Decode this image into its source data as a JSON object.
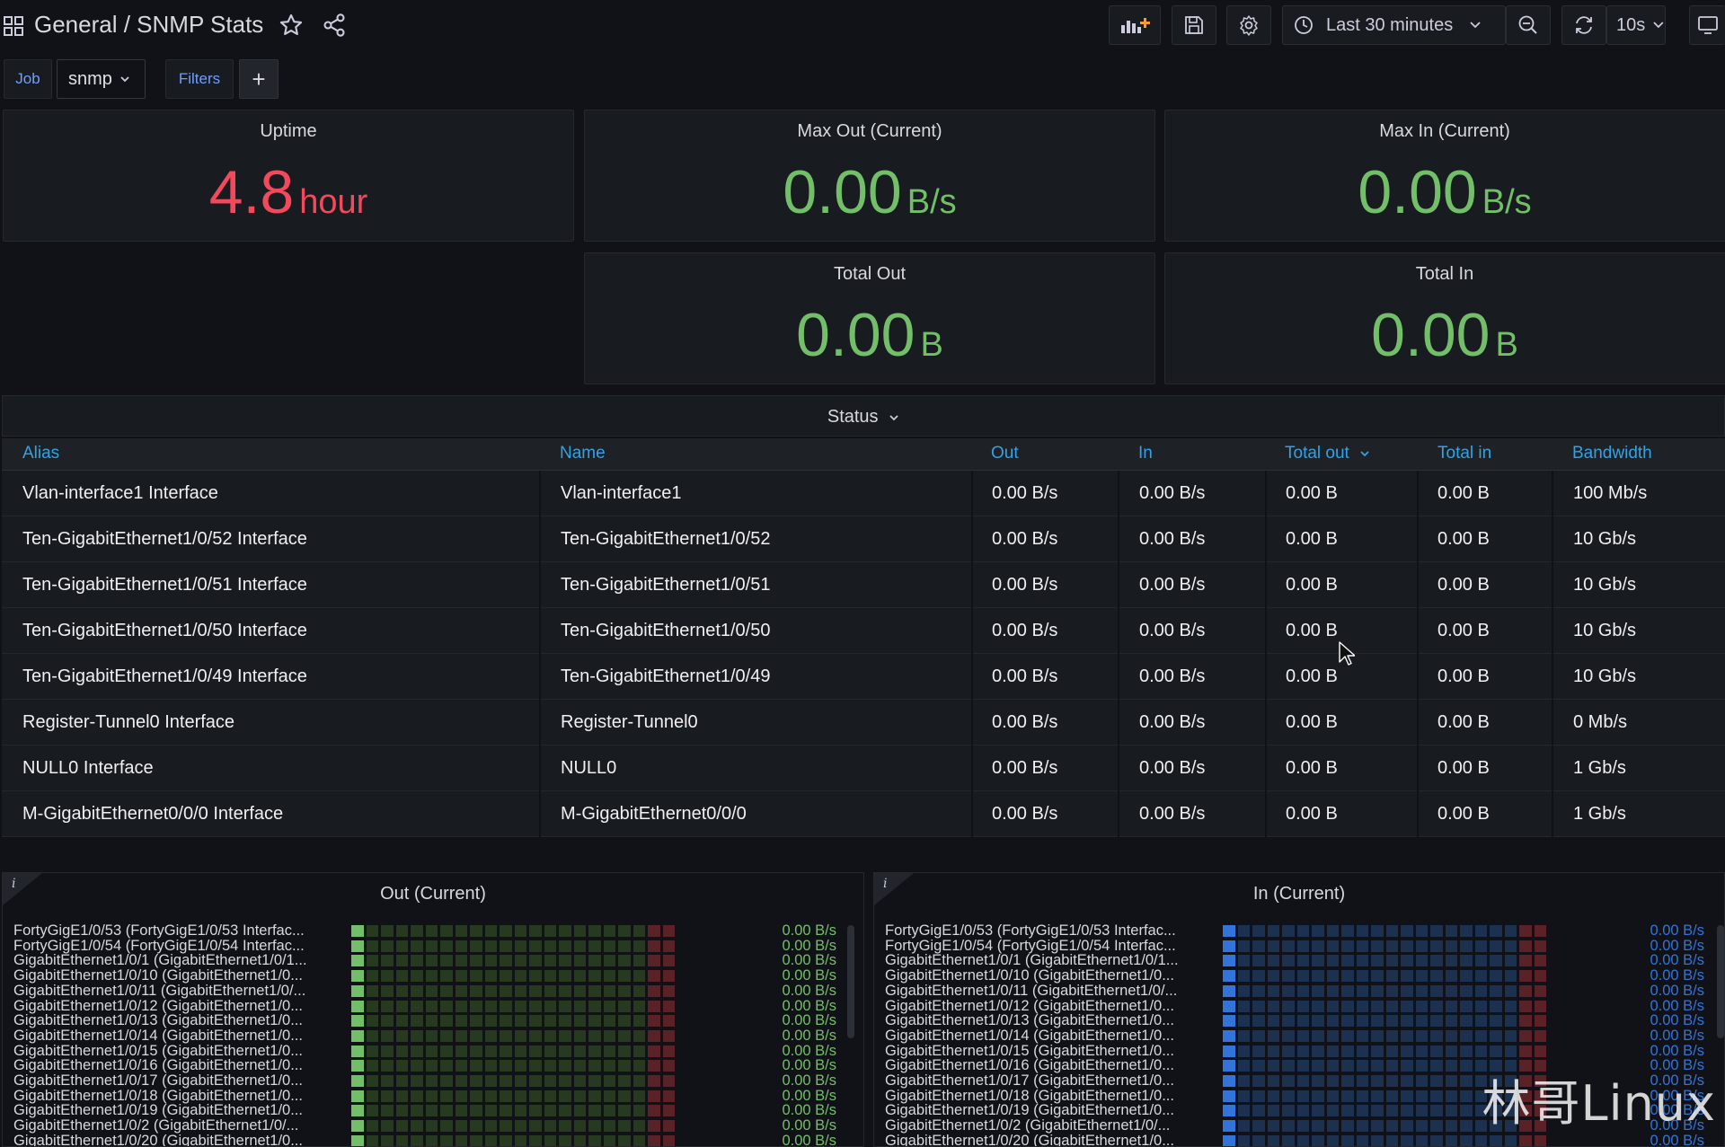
{
  "header": {
    "breadcrumb_folder": "General",
    "breadcrumb_sep": " / ",
    "dashboard_title": "SNMP Stats",
    "time_range": "Last 30 minutes",
    "refresh_interval": "10s"
  },
  "variables": {
    "job_label": "Job",
    "job_value": "snmp",
    "filters_label": "Filters",
    "add_label": "+"
  },
  "stats": {
    "uptime": {
      "title": "Uptime",
      "value": "4.8",
      "unit": "hour",
      "color": "#f2495c"
    },
    "max_out": {
      "title": "Max Out (Current)",
      "value": "0.00",
      "unit": "B/s",
      "color": "#73bf69"
    },
    "max_in": {
      "title": "Max In (Current)",
      "value": "0.00",
      "unit": "B/s",
      "color": "#73bf69"
    },
    "total_out": {
      "title": "Total Out",
      "value": "0.00",
      "unit": "B",
      "color": "#73bf69"
    },
    "total_in": {
      "title": "Total In",
      "value": "0.00",
      "unit": "B",
      "color": "#73bf69"
    }
  },
  "status_table": {
    "title": "Status",
    "headers": [
      "Alias",
      "Name",
      "Out",
      "In",
      "Total out",
      "Total in",
      "Bandwidth"
    ],
    "rows": [
      [
        "Vlan-interface1 Interface",
        "Vlan-interface1",
        "0.00 B/s",
        "0.00 B/s",
        "0.00 B",
        "0.00 B",
        "100 Mb/s"
      ],
      [
        "Ten-GigabitEthernet1/0/52 Interface",
        "Ten-GigabitEthernet1/0/52",
        "0.00 B/s",
        "0.00 B/s",
        "0.00 B",
        "0.00 B",
        "10 Gb/s"
      ],
      [
        "Ten-GigabitEthernet1/0/51 Interface",
        "Ten-GigabitEthernet1/0/51",
        "0.00 B/s",
        "0.00 B/s",
        "0.00 B",
        "0.00 B",
        "10 Gb/s"
      ],
      [
        "Ten-GigabitEthernet1/0/50 Interface",
        "Ten-GigabitEthernet1/0/50",
        "0.00 B/s",
        "0.00 B/s",
        "0.00 B",
        "0.00 B",
        "10 Gb/s"
      ],
      [
        "Ten-GigabitEthernet1/0/49 Interface",
        "Ten-GigabitEthernet1/0/49",
        "0.00 B/s",
        "0.00 B/s",
        "0.00 B",
        "0.00 B",
        "10 Gb/s"
      ],
      [
        "Register-Tunnel0 Interface",
        "Register-Tunnel0",
        "0.00 B/s",
        "0.00 B/s",
        "0.00 B",
        "0.00 B",
        "0 Mb/s"
      ],
      [
        "NULL0 Interface",
        "NULL0",
        "0.00 B/s",
        "0.00 B/s",
        "0.00 B",
        "0.00 B",
        "1 Gb/s"
      ],
      [
        "M-GigabitEthernet0/0/0 Interface",
        "M-GigabitEthernet0/0/0",
        "0.00 B/s",
        "0.00 B/s",
        "0.00 B",
        "0.00 B",
        "1 Gb/s"
      ]
    ]
  },
  "out_panel": {
    "title": "Out (Current)",
    "color": "#73bf69",
    "labels": [
      "FortyGigE1/0/53 (FortyGigE1/0/53 Interfac...",
      "FortyGigE1/0/54 (FortyGigE1/0/54 Interfac...",
      "GigabitEthernet1/0/1 (GigabitEthernet1/0/1...",
      "GigabitEthernet1/0/10 (GigabitEthernet1/0...",
      "GigabitEthernet1/0/11 (GigabitEthernet1/0/...",
      "GigabitEthernet1/0/12 (GigabitEthernet1/0...",
      "GigabitEthernet1/0/13 (GigabitEthernet1/0...",
      "GigabitEthernet1/0/14 (GigabitEthernet1/0...",
      "GigabitEthernet1/0/15 (GigabitEthernet1/0...",
      "GigabitEthernet1/0/16 (GigabitEthernet1/0...",
      "GigabitEthernet1/0/17 (GigabitEthernet1/0...",
      "GigabitEthernet1/0/18 (GigabitEthernet1/0...",
      "GigabitEthernet1/0/19 (GigabitEthernet1/0...",
      "GigabitEthernet1/0/2 (GigabitEthernet1/0/...",
      "GigabitEthernet1/0/20 (GigabitEthernet1/0..."
    ],
    "values": [
      "0.00 B/s",
      "0.00 B/s",
      "0.00 B/s",
      "0.00 B/s",
      "0.00 B/s",
      "0.00 B/s",
      "0.00 B/s",
      "0.00 B/s",
      "0.00 B/s",
      "0.00 B/s",
      "0.00 B/s",
      "0.00 B/s",
      "0.00 B/s",
      "0.00 B/s",
      "0.00 B/s"
    ]
  },
  "in_panel": {
    "title": "In (Current)",
    "color": "#3274d9",
    "labels": [
      "FortyGigE1/0/53 (FortyGigE1/0/53 Interfac...",
      "FortyGigE1/0/54 (FortyGigE1/0/54 Interfac...",
      "GigabitEthernet1/0/1 (GigabitEthernet1/0/1...",
      "GigabitEthernet1/0/10 (GigabitEthernet1/0...",
      "GigabitEthernet1/0/11 (GigabitEthernet1/0/...",
      "GigabitEthernet1/0/12 (GigabitEthernet1/0...",
      "GigabitEthernet1/0/13 (GigabitEthernet1/0...",
      "GigabitEthernet1/0/14 (GigabitEthernet1/0...",
      "GigabitEthernet1/0/15 (GigabitEthernet1/0...",
      "GigabitEthernet1/0/16 (GigabitEthernet1/0...",
      "GigabitEthernet1/0/17 (GigabitEthernet1/0...",
      "GigabitEthernet1/0/18 (GigabitEthernet1/0...",
      "GigabitEthernet1/0/19 (GigabitEthernet1/0...",
      "GigabitEthernet1/0/2 (GigabitEthernet1/0/...",
      "GigabitEthernet1/0/20 (GigabitEthernet1/0..."
    ],
    "values": [
      "0.00 B/s",
      "0.00 B/s",
      "0.00 B/s",
      "0.00 B/s",
      "0.00 B/s",
      "0.00 B/s",
      "0.00 B/s",
      "0.00 B/s",
      "0.00 B/s",
      "0.00 B/s",
      "0.00 B/s",
      "0.00 B/s",
      "0.00 B/s",
      "0.00 B/s",
      "0.00 B/s"
    ]
  },
  "watermark": "林哥Linux"
}
